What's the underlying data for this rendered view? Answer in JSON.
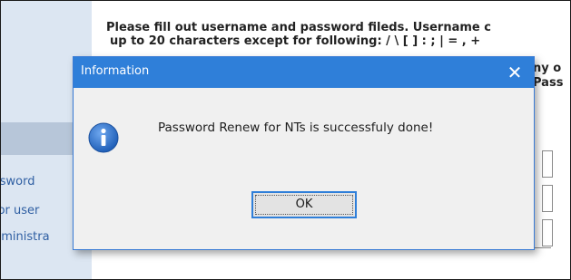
{
  "page": {
    "instructions_line1": "Please fill out username and password fileds. Username c",
    "instructions_line2": "up to 20 characters except for following: / \\ [ ] : ; | = , +",
    "side_text_1": "ny o",
    "side_text_2": "Pass"
  },
  "sidebar": {
    "links": [
      {
        "label": "ssword"
      },
      {
        "label": "for user"
      },
      {
        "label": "dministra"
      }
    ]
  },
  "dialog": {
    "title": "Information",
    "close_label": "✕",
    "message": "Password Renew for NTs is successfuly done!",
    "ok_label": "OK",
    "icon": "info-icon"
  },
  "colors": {
    "titlebar": "#2f7fd9",
    "sidebar_bg": "#dce6f2",
    "icon_blue": "#1f5fb8"
  }
}
